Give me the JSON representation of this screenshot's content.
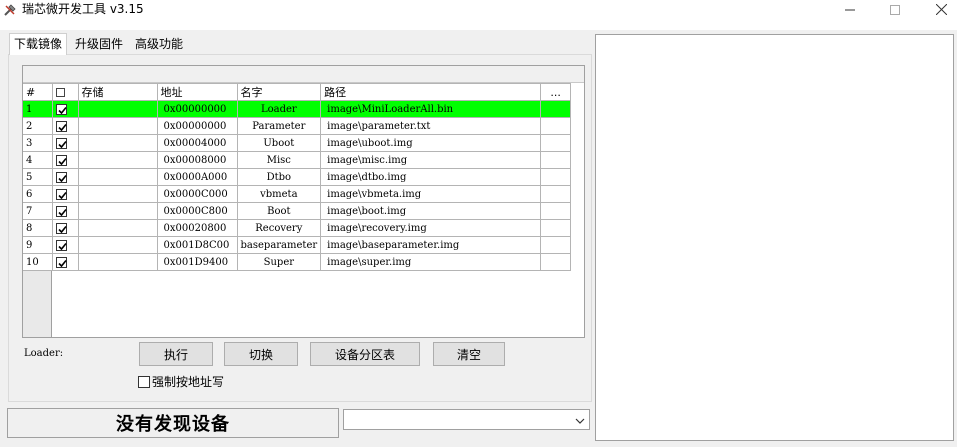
{
  "app": {
    "title": "瑞芯微开发工具 v3.15"
  },
  "window_controls": {
    "minimize_icon": "minimize-icon",
    "maximize_icon": "maximize-icon",
    "close_icon": "close-icon"
  },
  "tabs": [
    {
      "label": "下载镜像",
      "active": true
    },
    {
      "label": "升级固件",
      "active": false
    },
    {
      "label": "高级功能",
      "active": false
    }
  ],
  "grid": {
    "headers": {
      "index": "#",
      "storage": "存储",
      "address": "地址",
      "name": "名字",
      "path": "路径",
      "more": "..."
    },
    "rows": [
      {
        "index": "1",
        "checked": true,
        "storage": "",
        "address": "0x00000000",
        "name": "Loader",
        "path": "image\\MiniLoaderAll.bin",
        "selected": true
      },
      {
        "index": "2",
        "checked": true,
        "storage": "",
        "address": "0x00000000",
        "name": "Parameter",
        "path": "image\\parameter.txt",
        "selected": false
      },
      {
        "index": "3",
        "checked": true,
        "storage": "",
        "address": "0x00004000",
        "name": "Uboot",
        "path": "image\\uboot.img",
        "selected": false
      },
      {
        "index": "4",
        "checked": true,
        "storage": "",
        "address": "0x00008000",
        "name": "Misc",
        "path": "image\\misc.img",
        "selected": false
      },
      {
        "index": "5",
        "checked": true,
        "storage": "",
        "address": "0x0000A000",
        "name": "Dtbo",
        "path": "image\\dtbo.img",
        "selected": false
      },
      {
        "index": "6",
        "checked": true,
        "storage": "",
        "address": "0x0000C000",
        "name": "vbmeta",
        "path": "image\\vbmeta.img",
        "selected": false
      },
      {
        "index": "7",
        "checked": true,
        "storage": "",
        "address": "0x0000C800",
        "name": "Boot",
        "path": "image\\boot.img",
        "selected": false
      },
      {
        "index": "8",
        "checked": true,
        "storage": "",
        "address": "0x00020800",
        "name": "Recovery",
        "path": "image\\recovery.img",
        "selected": false
      },
      {
        "index": "9",
        "checked": true,
        "storage": "",
        "address": "0x001D8C00",
        "name": "baseparameter",
        "path": "image\\baseparameter.img",
        "selected": false
      },
      {
        "index": "10",
        "checked": true,
        "storage": "",
        "address": "0x001D9400",
        "name": "Super",
        "path": "image\\super.img",
        "selected": false
      }
    ],
    "selected_color": "#00ff00"
  },
  "controls": {
    "loader_label": "Loader:",
    "exec_button": "执行",
    "switch_button": "切换",
    "partition_button": "设备分区表",
    "clear_button": "清空",
    "force_address_label": "强制按地址写",
    "force_address_checked": false
  },
  "status": {
    "text": "没有发现设备",
    "combo_value": ""
  }
}
